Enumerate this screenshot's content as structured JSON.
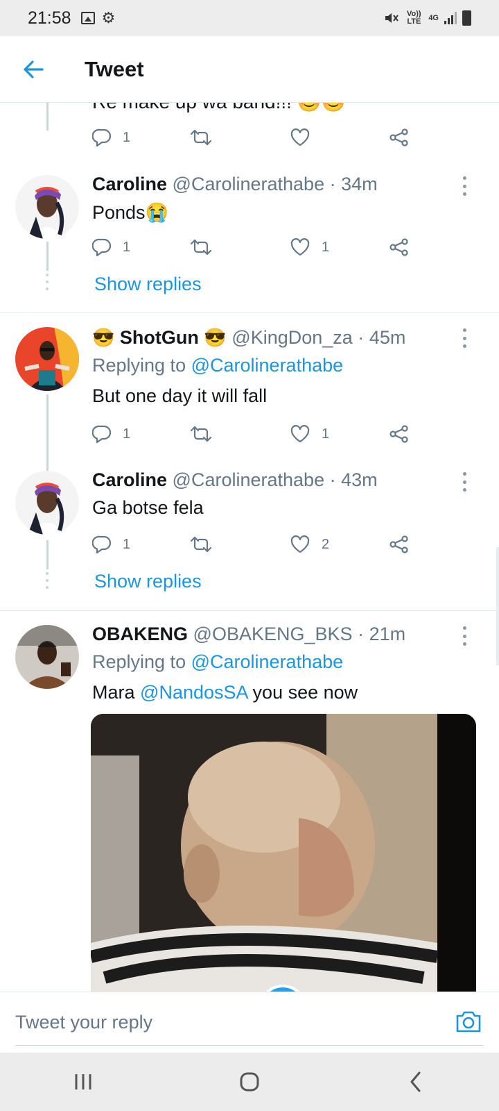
{
  "status_bar": {
    "time": "21:58",
    "volte_label": "Vo)) LTE",
    "network_label": "4G",
    "icons": [
      "image-icon",
      "gear-icon",
      "mute-icon",
      "signal-icon",
      "battery-icon"
    ]
  },
  "header": {
    "title": "Tweet",
    "back_icon": "arrow-left-icon"
  },
  "colors": {
    "accent": "#1b95e0",
    "text": "#14171a",
    "muted": "#657786",
    "divider": "#e1e8ed"
  },
  "partial_tweet": {
    "text": "Re make up wa band!!! 😊😊"
  },
  "partial_actions": {
    "reply_count": "1",
    "retweet_count": "",
    "like_count": "",
    "share_count": ""
  },
  "tweets": [
    {
      "name": "Caroline",
      "handle": "@Carolinerathabe",
      "time": "34m",
      "text": "Ponds😭",
      "actions": {
        "reply_count": "1",
        "retweet_count": "",
        "like_count": "1"
      }
    },
    {
      "name": "ShotGun",
      "name_emoji": "😎",
      "handle": "@KingDon_za",
      "time": "45m",
      "replying_label": "Replying to",
      "replying_to": "@Carolinerathabe",
      "text": "But one day it will fall",
      "actions": {
        "reply_count": "1",
        "retweet_count": "",
        "like_count": "1"
      }
    },
    {
      "name": "Caroline",
      "handle": "@Carolinerathabe",
      "time": "43m",
      "text": "Ga botse fela",
      "actions": {
        "reply_count": "1",
        "retweet_count": "",
        "like_count": "2"
      }
    },
    {
      "name": "OBAKENG",
      "handle": "@OBAKENG_BKS",
      "time": "21m",
      "replying_label": "Replying to",
      "replying_to": "@Carolinerathabe",
      "text_prefix": "Mara",
      "text_mention": "@NandosSA",
      "text_suffix": "you see now",
      "media": "gif-video"
    }
  ],
  "show_replies_label": "Show replies",
  "separator": "·",
  "reply_bar": {
    "placeholder": "Tweet your reply",
    "camera_icon": "camera-icon"
  },
  "nav_bar": {
    "icons": [
      "recents-icon",
      "home-icon",
      "back-icon"
    ]
  }
}
